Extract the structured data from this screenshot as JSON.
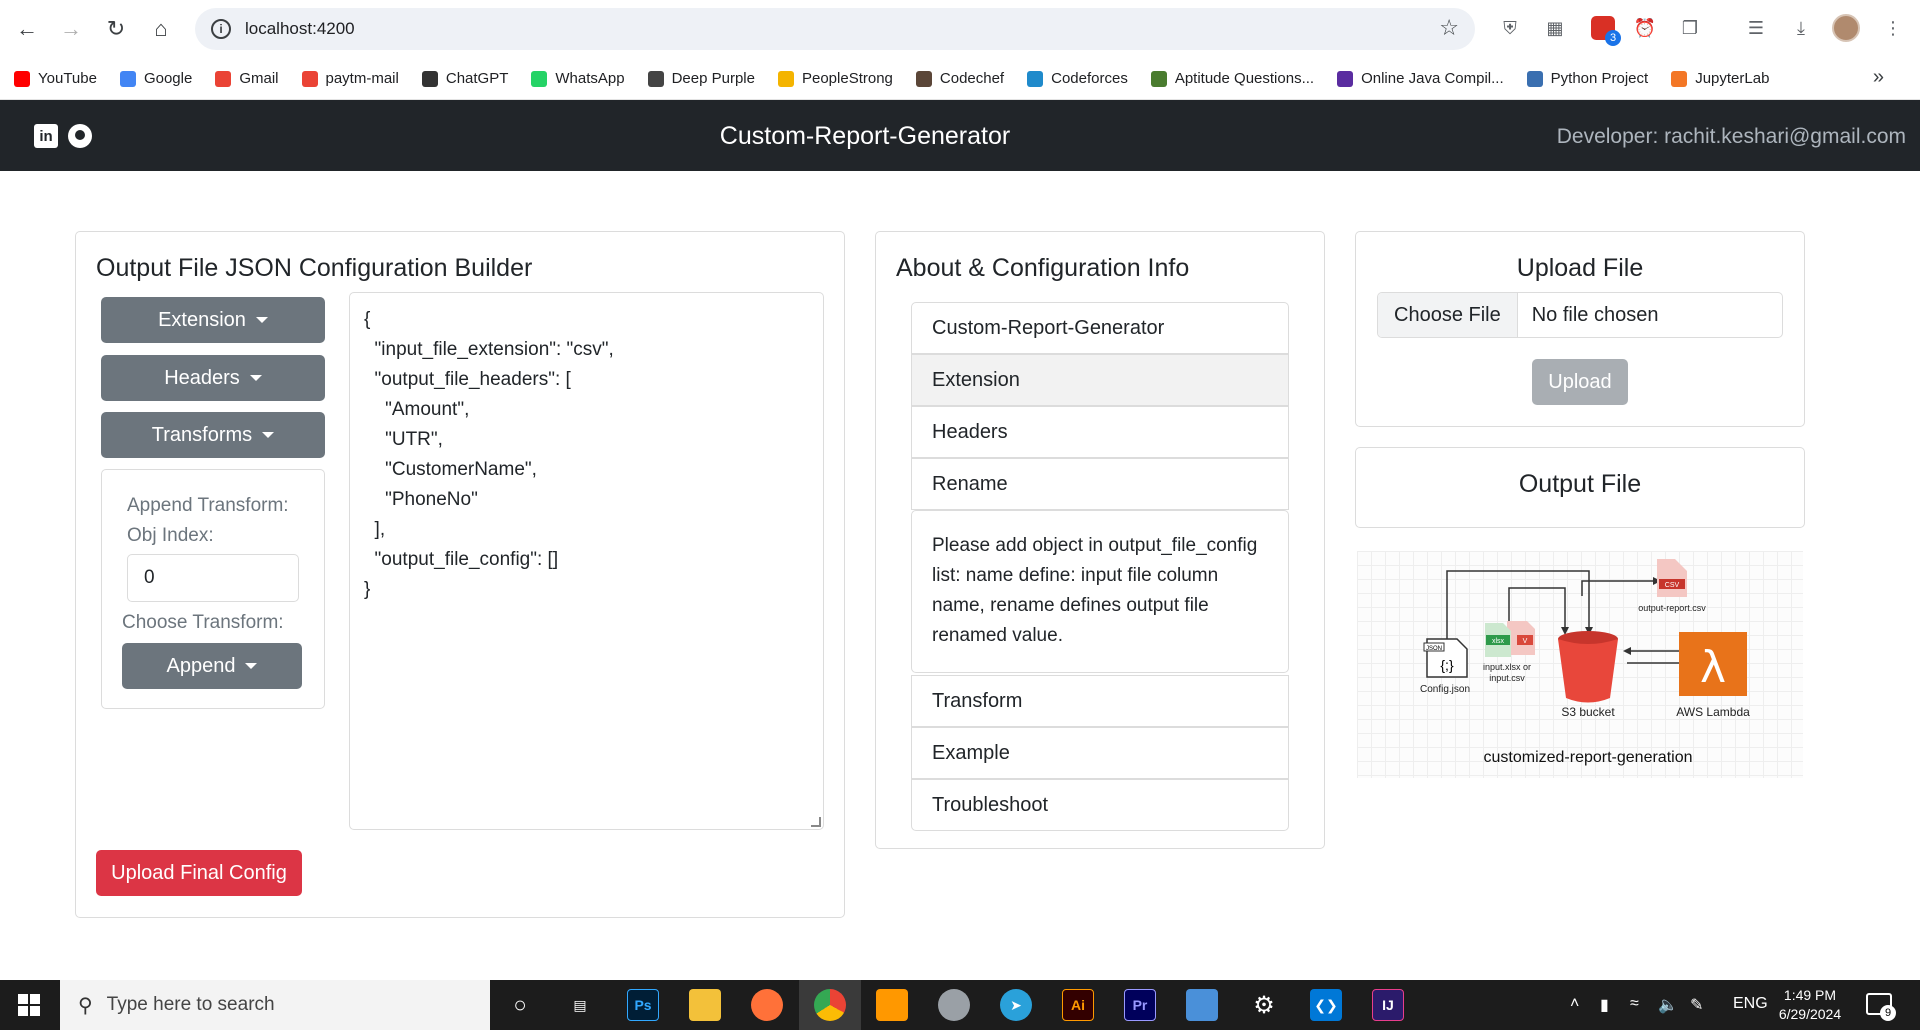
{
  "browser": {
    "url": "localhost:4200",
    "bookmarks": [
      {
        "label": "YouTube",
        "icon": "youtube-icon",
        "color": "#ff0000"
      },
      {
        "label": "Google",
        "icon": "google-icon",
        "color": "#4285f4"
      },
      {
        "label": "Gmail",
        "icon": "gmail-icon",
        "color": "#ea4335"
      },
      {
        "label": "paytm-mail",
        "icon": "gmail-icon",
        "color": "#ea4335"
      },
      {
        "label": "ChatGPT",
        "icon": "chatgpt-icon",
        "color": "#333333"
      },
      {
        "label": "WhatsApp",
        "icon": "whatsapp-icon",
        "color": "#25d366"
      },
      {
        "label": "Deep Purple",
        "icon": "globe-icon",
        "color": "#444444"
      },
      {
        "label": "PeopleStrong",
        "icon": "peoplestrong-icon",
        "color": "#f4b400"
      },
      {
        "label": "Codechef",
        "icon": "codechef-icon",
        "color": "#5b4638"
      },
      {
        "label": "Codeforces",
        "icon": "codeforces-icon",
        "color": "#1f8acb"
      },
      {
        "label": "Aptitude Questions...",
        "icon": "aptitude-icon",
        "color": "#4a7c2f"
      },
      {
        "label": "Online Java Compil...",
        "icon": "java-icon",
        "color": "#5a2ca0"
      },
      {
        "label": "Python Project",
        "icon": "python-icon",
        "color": "#3a6fb0"
      },
      {
        "label": "JupyterLab",
        "icon": "jupyter-icon",
        "color": "#f37726"
      }
    ],
    "extension_badge": "3"
  },
  "navbar": {
    "title": "Custom-Report-Generator",
    "developer": "Developer: rachit.keshari@gmail.com"
  },
  "builder": {
    "title": "Output File JSON Configuration Builder",
    "dropdowns": [
      "Extension",
      "Headers",
      "Transforms"
    ],
    "append_label_1": "Append Transform:",
    "append_label_2": "Obj Index:",
    "obj_index_value": "0",
    "choose_label": "Choose Transform:",
    "choose_value": "Append",
    "json_text": "{\n  \"input_file_extension\": \"csv\",\n  \"output_file_headers\": [\n    \"Amount\",\n    \"UTR\",\n    \"CustomerName\",\n    \"PhoneNo\"\n  ],\n  \"output_file_config\": []\n}",
    "upload_button": "Upload Final Config"
  },
  "about": {
    "title": "About & Configuration Info",
    "items": [
      "Custom-Report-Generator",
      "Extension",
      "Headers",
      "Rename",
      "Transform",
      "Example",
      "Troubleshoot"
    ],
    "rename_body": "Please add object in output_file_config list: name define: input file column name, rename defines output file renamed value."
  },
  "upload": {
    "title": "Upload File",
    "choose_button": "Choose File",
    "no_file": "No file chosen",
    "upload_button": "Upload"
  },
  "output": {
    "title": "Output File",
    "diagram": {
      "caption": "customized-report-generation",
      "config_label": "Config.json",
      "config_tag": "JSON",
      "input_label_1": "input.xlsx or",
      "input_label_2": "input.csv",
      "xlsx_tag": "xlsx",
      "csv_tag": "CSV",
      "s3_label": "S3 bucket",
      "lambda_label": "AWS Lambda",
      "output_label": "output-report.csv"
    }
  },
  "taskbar": {
    "search_placeholder": "Type here to search",
    "language": "ENG",
    "time": "1:49 PM",
    "date": "6/29/2024",
    "notification_count": "9"
  },
  "colors": {
    "navbar_bg": "#212529",
    "secondary_btn": "#6c757d",
    "danger_btn": "#dc3545",
    "disabled_btn": "#a9aeb3"
  }
}
